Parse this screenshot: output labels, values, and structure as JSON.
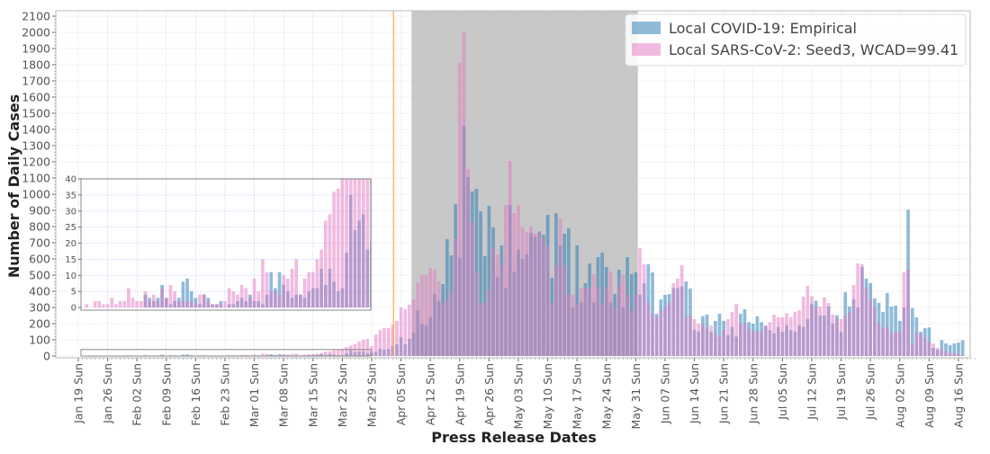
{
  "chart_data": {
    "type": "bar",
    "xlabel": "Press Release Dates",
    "ylabel": "Number of Daily Cases",
    "ylim": [
      0,
      2100
    ],
    "y_ticks": [
      0,
      100,
      200,
      300,
      400,
      500,
      600,
      700,
      800,
      900,
      1000,
      1100,
      1200,
      1300,
      1400,
      1500,
      1600,
      1700,
      1800,
      1900,
      2000,
      2100
    ],
    "x_tick_labels": [
      "Jan 19 Sun",
      "Jan 26 Sun",
      "Feb 02 Sun",
      "Feb 09 Sun",
      "Feb 16 Sun",
      "Feb 23 Sun",
      "Mar 01 Sun",
      "Mar 08 Sun",
      "Mar 15 Sun",
      "Mar 22 Sun",
      "Mar 29 Sun",
      "Apr 05 Sun",
      "Apr 12 Sun",
      "Apr 19 Sun",
      "Apr 26 Sun",
      "May 03 Sun",
      "May 10 Sun",
      "May 17 Sun",
      "May 24 Sun",
      "May 31 Sun",
      "Jun 07 Sun",
      "Jun 14 Sun",
      "Jun 21 Sun",
      "Jun 28 Sun",
      "Jul 05 Sun",
      "Jul 12 Sun",
      "Jul 19 Sun",
      "Jul 26 Sun",
      "Aug 02 Sun",
      "Aug 09 Sun",
      "Aug 16 Sun"
    ],
    "grid": true,
    "legend_placement": "top-right",
    "shaded_period": [
      "Apr 07",
      "May 31"
    ],
    "vertical_line_date": "Apr 03",
    "colors": {
      "empirical": "#1f77b4",
      "simulated": "#e377c2",
      "shade": "#c8c8c8",
      "vline": "#ffa64d",
      "inset_grid": "#c8c8ff"
    },
    "dates": [
      "Jan 19",
      "Jan 20",
      "Jan 21",
      "Jan 22",
      "Jan 23",
      "Jan 24",
      "Jan 25",
      "Jan 26",
      "Jan 27",
      "Jan 28",
      "Jan 29",
      "Jan 30",
      "Jan 31",
      "Feb 01",
      "Feb 02",
      "Feb 03",
      "Feb 04",
      "Feb 05",
      "Feb 06",
      "Feb 07",
      "Feb 08",
      "Feb 09",
      "Feb 10",
      "Feb 11",
      "Feb 12",
      "Feb 13",
      "Feb 14",
      "Feb 15",
      "Feb 16",
      "Feb 17",
      "Feb 18",
      "Feb 19",
      "Feb 20",
      "Feb 21",
      "Feb 22",
      "Feb 23",
      "Feb 24",
      "Feb 25",
      "Feb 26",
      "Feb 27",
      "Feb 28",
      "Feb 29",
      "Mar 01",
      "Mar 02",
      "Mar 03",
      "Mar 04",
      "Mar 05",
      "Mar 06",
      "Mar 07",
      "Mar 08",
      "Mar 09",
      "Mar 10",
      "Mar 11",
      "Mar 12",
      "Mar 13",
      "Mar 14",
      "Mar 15",
      "Mar 16",
      "Mar 17",
      "Mar 18",
      "Mar 19",
      "Mar 20",
      "Mar 21",
      "Mar 22",
      "Mar 23",
      "Mar 24",
      "Mar 25",
      "Mar 26",
      "Mar 27",
      "Mar 28",
      "Mar 29",
      "Mar 30",
      "Mar 31",
      "Apr 01",
      "Apr 02",
      "Apr 03",
      "Apr 04",
      "Apr 05",
      "Apr 06",
      "Apr 07",
      "Apr 08",
      "Apr 09",
      "Apr 10",
      "Apr 11",
      "Apr 12",
      "Apr 13",
      "Apr 14",
      "Apr 15",
      "Apr 16",
      "Apr 17",
      "Apr 18",
      "Apr 19",
      "Apr 20",
      "Apr 21",
      "Apr 22",
      "Apr 23",
      "Apr 24",
      "Apr 25",
      "Apr 26",
      "Apr 27",
      "Apr 28",
      "Apr 29",
      "Apr 30",
      "May 01",
      "May 02",
      "May 03",
      "May 04",
      "May 05",
      "May 06",
      "May 07",
      "May 08",
      "May 09",
      "May 10",
      "May 11",
      "May 12",
      "May 13",
      "May 14",
      "May 15",
      "May 16",
      "May 17",
      "May 18",
      "May 19",
      "May 20",
      "May 21",
      "May 22",
      "May 23",
      "May 24",
      "May 25",
      "May 26",
      "May 27",
      "May 28",
      "May 29",
      "May 30",
      "May 31",
      "Jun 01",
      "Jun 02",
      "Jun 03",
      "Jun 04",
      "Jun 05",
      "Jun 06",
      "Jun 07",
      "Jun 08",
      "Jun 09",
      "Jun 10",
      "Jun 11",
      "Jun 12",
      "Jun 13",
      "Jun 14",
      "Jun 15",
      "Jun 16",
      "Jun 17",
      "Jun 18",
      "Jun 19",
      "Jun 20",
      "Jun 21",
      "Jun 22",
      "Jun 23",
      "Jun 24",
      "Jun 25",
      "Jun 26",
      "Jun 27",
      "Jun 28",
      "Jun 29",
      "Jun 30",
      "Jul 01",
      "Jul 02",
      "Jul 03",
      "Jul 04",
      "Jul 05",
      "Jul 06",
      "Jul 07",
      "Jul 08",
      "Jul 09",
      "Jul 10",
      "Jul 11",
      "Jul 12",
      "Jul 13",
      "Jul 14",
      "Jul 15",
      "Jul 16",
      "Jul 17",
      "Jul 18",
      "Jul 19",
      "Jul 20",
      "Jul 21",
      "Jul 22",
      "Jul 23",
      "Jul 24",
      "Jul 25",
      "Jul 26",
      "Jul 27",
      "Jul 28",
      "Jul 29",
      "Jul 30",
      "Jul 31",
      "Aug 01",
      "Aug 02",
      "Aug 03",
      "Aug 04",
      "Aug 05",
      "Aug 06",
      "Aug 07",
      "Aug 08",
      "Aug 09",
      "Aug 10",
      "Aug 11",
      "Aug 12",
      "Aug 13",
      "Aug 14",
      "Aug 15",
      "Aug 16",
      "Aug 17"
    ],
    "series": [
      {
        "name": "Local COVID-19: Empirical",
        "key": "empirical",
        "values": [
          0,
          0,
          0,
          0,
          0,
          0,
          0,
          0,
          0,
          0,
          0,
          0,
          0,
          0,
          0,
          0,
          4,
          3,
          2,
          3,
          7,
          3,
          1,
          2,
          3,
          8,
          9,
          5,
          3,
          1,
          4,
          3,
          1,
          1,
          2,
          0,
          1,
          1,
          2,
          3,
          2,
          4,
          2,
          2,
          1,
          4,
          11,
          6,
          11,
          7,
          5,
          3,
          4,
          4,
          3,
          5,
          6,
          6,
          12,
          7,
          12,
          8,
          5,
          6,
          17,
          35,
          24,
          27,
          29,
          18,
          20,
          25,
          44,
          39,
          44,
          61,
          72,
          117,
          72,
          106,
          144,
          283,
          200,
          190,
          239,
          383,
          339,
          444,
          722,
          622,
          939,
          606,
          1422,
          1106,
          1017,
          1033,
          894,
          617,
          928,
          794,
          489,
          683,
          420,
          933,
          520,
          656,
          600,
          628,
          760,
          739,
          770,
          750,
          872,
          483,
          883,
          683,
          756,
          789,
          300,
          683,
          330,
          450,
          572,
          330,
          611,
          639,
          550,
          330,
          383,
          533,
          300,
          611,
          506,
          517,
          380,
          450,
          567,
          517,
          260,
          350,
          378,
          383,
          420,
          420,
          430,
          461,
          417,
          163,
          150,
          246,
          256,
          150,
          217,
          261,
          217,
          130,
          180,
          120,
          261,
          289,
          209,
          200,
          246,
          209,
          185,
          160,
          140,
          180,
          150,
          190,
          160,
          150,
          190,
          180,
          230,
          320,
          342,
          250,
          250,
          306,
          200,
          252,
          150,
          394,
          306,
          350,
          300,
          550,
          478,
          450,
          356,
          328,
          272,
          389,
          306,
          311,
          217,
          300,
          904,
          296,
          239,
          150,
          172,
          176,
          50,
          40,
          98,
          78,
          67,
          78,
          83,
          98
        ]
      },
      {
        "name": "Local SARS-CoV-2: Seed3, WCAD=99.41",
        "key": "simulated",
        "values": [
          0,
          0,
          1,
          0,
          2,
          2,
          1,
          1,
          3,
          1,
          2,
          2,
          6,
          3,
          2,
          2,
          5,
          2,
          4,
          2,
          6,
          3,
          7,
          5,
          2,
          2,
          2,
          2,
          1,
          4,
          4,
          2,
          1,
          1,
          1,
          2,
          6,
          5,
          4,
          7,
          6,
          3,
          9,
          5,
          15,
          11,
          5,
          5,
          4,
          10,
          9,
          12,
          15,
          4,
          9,
          11,
          11,
          15,
          18,
          27,
          29,
          36,
          37,
          45,
          55,
          65,
          75,
          90,
          100,
          105,
          61,
          133,
          160,
          172,
          172,
          194,
          217,
          300,
          289,
          317,
          350,
          450,
          500,
          500,
          544,
          533,
          461,
          330,
          350,
          400,
          728,
          1811,
          2006,
          1156,
          828,
          522,
          328,
          330,
          411,
          672,
          628,
          560,
          933,
          1206,
          883,
          933,
          794,
          767,
          800,
          757,
          767,
          728,
          683,
          330,
          560,
          850,
          560,
          380,
          380,
          317,
          422,
          420,
          420,
          506,
          430,
          320,
          420,
          522,
          300,
          440,
          506,
          380,
          280,
          380,
          667,
          567,
          330,
          260,
          240,
          280,
          300,
          330,
          450,
          478,
          561,
          239,
          250,
          228,
          200,
          200,
          170,
          189,
          140,
          120,
          160,
          228,
          272,
          322,
          200,
          200,
          170,
          150,
          160,
          150,
          190,
          209,
          256,
          239,
          239,
          265,
          239,
          272,
          283,
          367,
          433,
          370,
          300,
          306,
          361,
          328,
          256,
          230,
          228,
          250,
          272,
          439,
          572,
          567,
          420,
          350,
          300,
          200,
          170,
          180,
          140,
          150,
          150,
          517,
          533,
          70,
          150,
          136,
          110,
          90,
          78,
          50,
          40,
          30,
          20,
          20,
          10,
          5
        ]
      }
    ],
    "inset": {
      "ylim": [
        0,
        40
      ],
      "y_ticks": [
        0,
        5,
        10,
        15,
        20,
        25,
        30,
        35,
        40
      ],
      "xlim": [
        "Jan 19",
        "Mar 29"
      ]
    }
  }
}
